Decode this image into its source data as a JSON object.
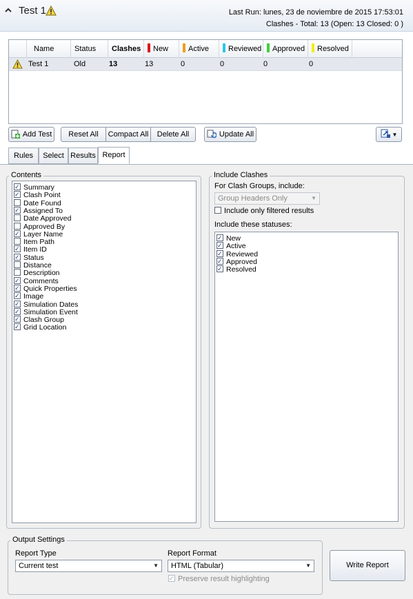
{
  "header": {
    "test_name": "Test 1",
    "last_run": "Last Run:  lunes, 23 de noviembre de 2015 17:53:01",
    "clashes_summary": "Clashes -  Total:  13  (Open:  13  Closed:  0 )"
  },
  "grid": {
    "columns": {
      "name": "Name",
      "status": "Status",
      "clashes": "Clashes",
      "new": "New",
      "active": "Active",
      "reviewed": "Reviewed",
      "approved": "Approved",
      "resolved": "Resolved"
    },
    "status_colors": {
      "new": "#e0141b",
      "active": "#f29c1c",
      "reviewed": "#2cc6f0",
      "approved": "#3fd13c",
      "resolved": "#f5ea1c"
    },
    "row": {
      "name": "Test 1",
      "status": "Old",
      "clashes": "13",
      "new": "13",
      "active": "0",
      "reviewed": "0",
      "approved": "0",
      "resolved": "0"
    }
  },
  "toolbar": {
    "add_test": "Add Test",
    "reset_all": "Reset All",
    "compact_all": "Compact All",
    "delete_all": "Delete All",
    "update_all": "Update All"
  },
  "tabs": {
    "rules": "Rules",
    "select": "Select",
    "results": "Results",
    "report": "Report"
  },
  "contents": {
    "title": "Contents",
    "items": [
      {
        "label": "Summary",
        "checked": true
      },
      {
        "label": "Clash Point",
        "checked": true
      },
      {
        "label": "Date Found",
        "checked": false
      },
      {
        "label": "Assigned To",
        "checked": true
      },
      {
        "label": "Date Approved",
        "checked": false
      },
      {
        "label": "Approved By",
        "checked": false
      },
      {
        "label": "Layer Name",
        "checked": true
      },
      {
        "label": "Item Path",
        "checked": false
      },
      {
        "label": "Item ID",
        "checked": true
      },
      {
        "label": "Status",
        "checked": true
      },
      {
        "label": "Distance",
        "checked": false
      },
      {
        "label": "Description",
        "checked": false
      },
      {
        "label": "Comments",
        "checked": true
      },
      {
        "label": "Quick Properties",
        "checked": true
      },
      {
        "label": "Image",
        "checked": true
      },
      {
        "label": "Simulation Dates",
        "checked": true
      },
      {
        "label": "Simulation Event",
        "checked": true
      },
      {
        "label": "Clash Group",
        "checked": true
      },
      {
        "label": "Grid Location",
        "checked": true
      }
    ]
  },
  "include_clashes": {
    "title": "Include Clashes",
    "groups_label": "For Clash Groups, include:",
    "groups_value": "Group Headers Only",
    "only_filtered_label": "Include only filtered results",
    "only_filtered_checked": false,
    "statuses_label": "Include these statuses:",
    "statuses": [
      {
        "label": "New",
        "checked": true
      },
      {
        "label": "Active",
        "checked": true
      },
      {
        "label": "Reviewed",
        "checked": true
      },
      {
        "label": "Approved",
        "checked": true
      },
      {
        "label": "Resolved",
        "checked": true
      }
    ]
  },
  "output": {
    "title": "Output Settings",
    "report_type_label": "Report Type",
    "report_type_value": "Current test",
    "report_format_label": "Report Format",
    "report_format_value": "HTML (Tabular)",
    "preserve_label": "Preserve result highlighting",
    "preserve_checked": true,
    "write_report": "Write Report"
  }
}
